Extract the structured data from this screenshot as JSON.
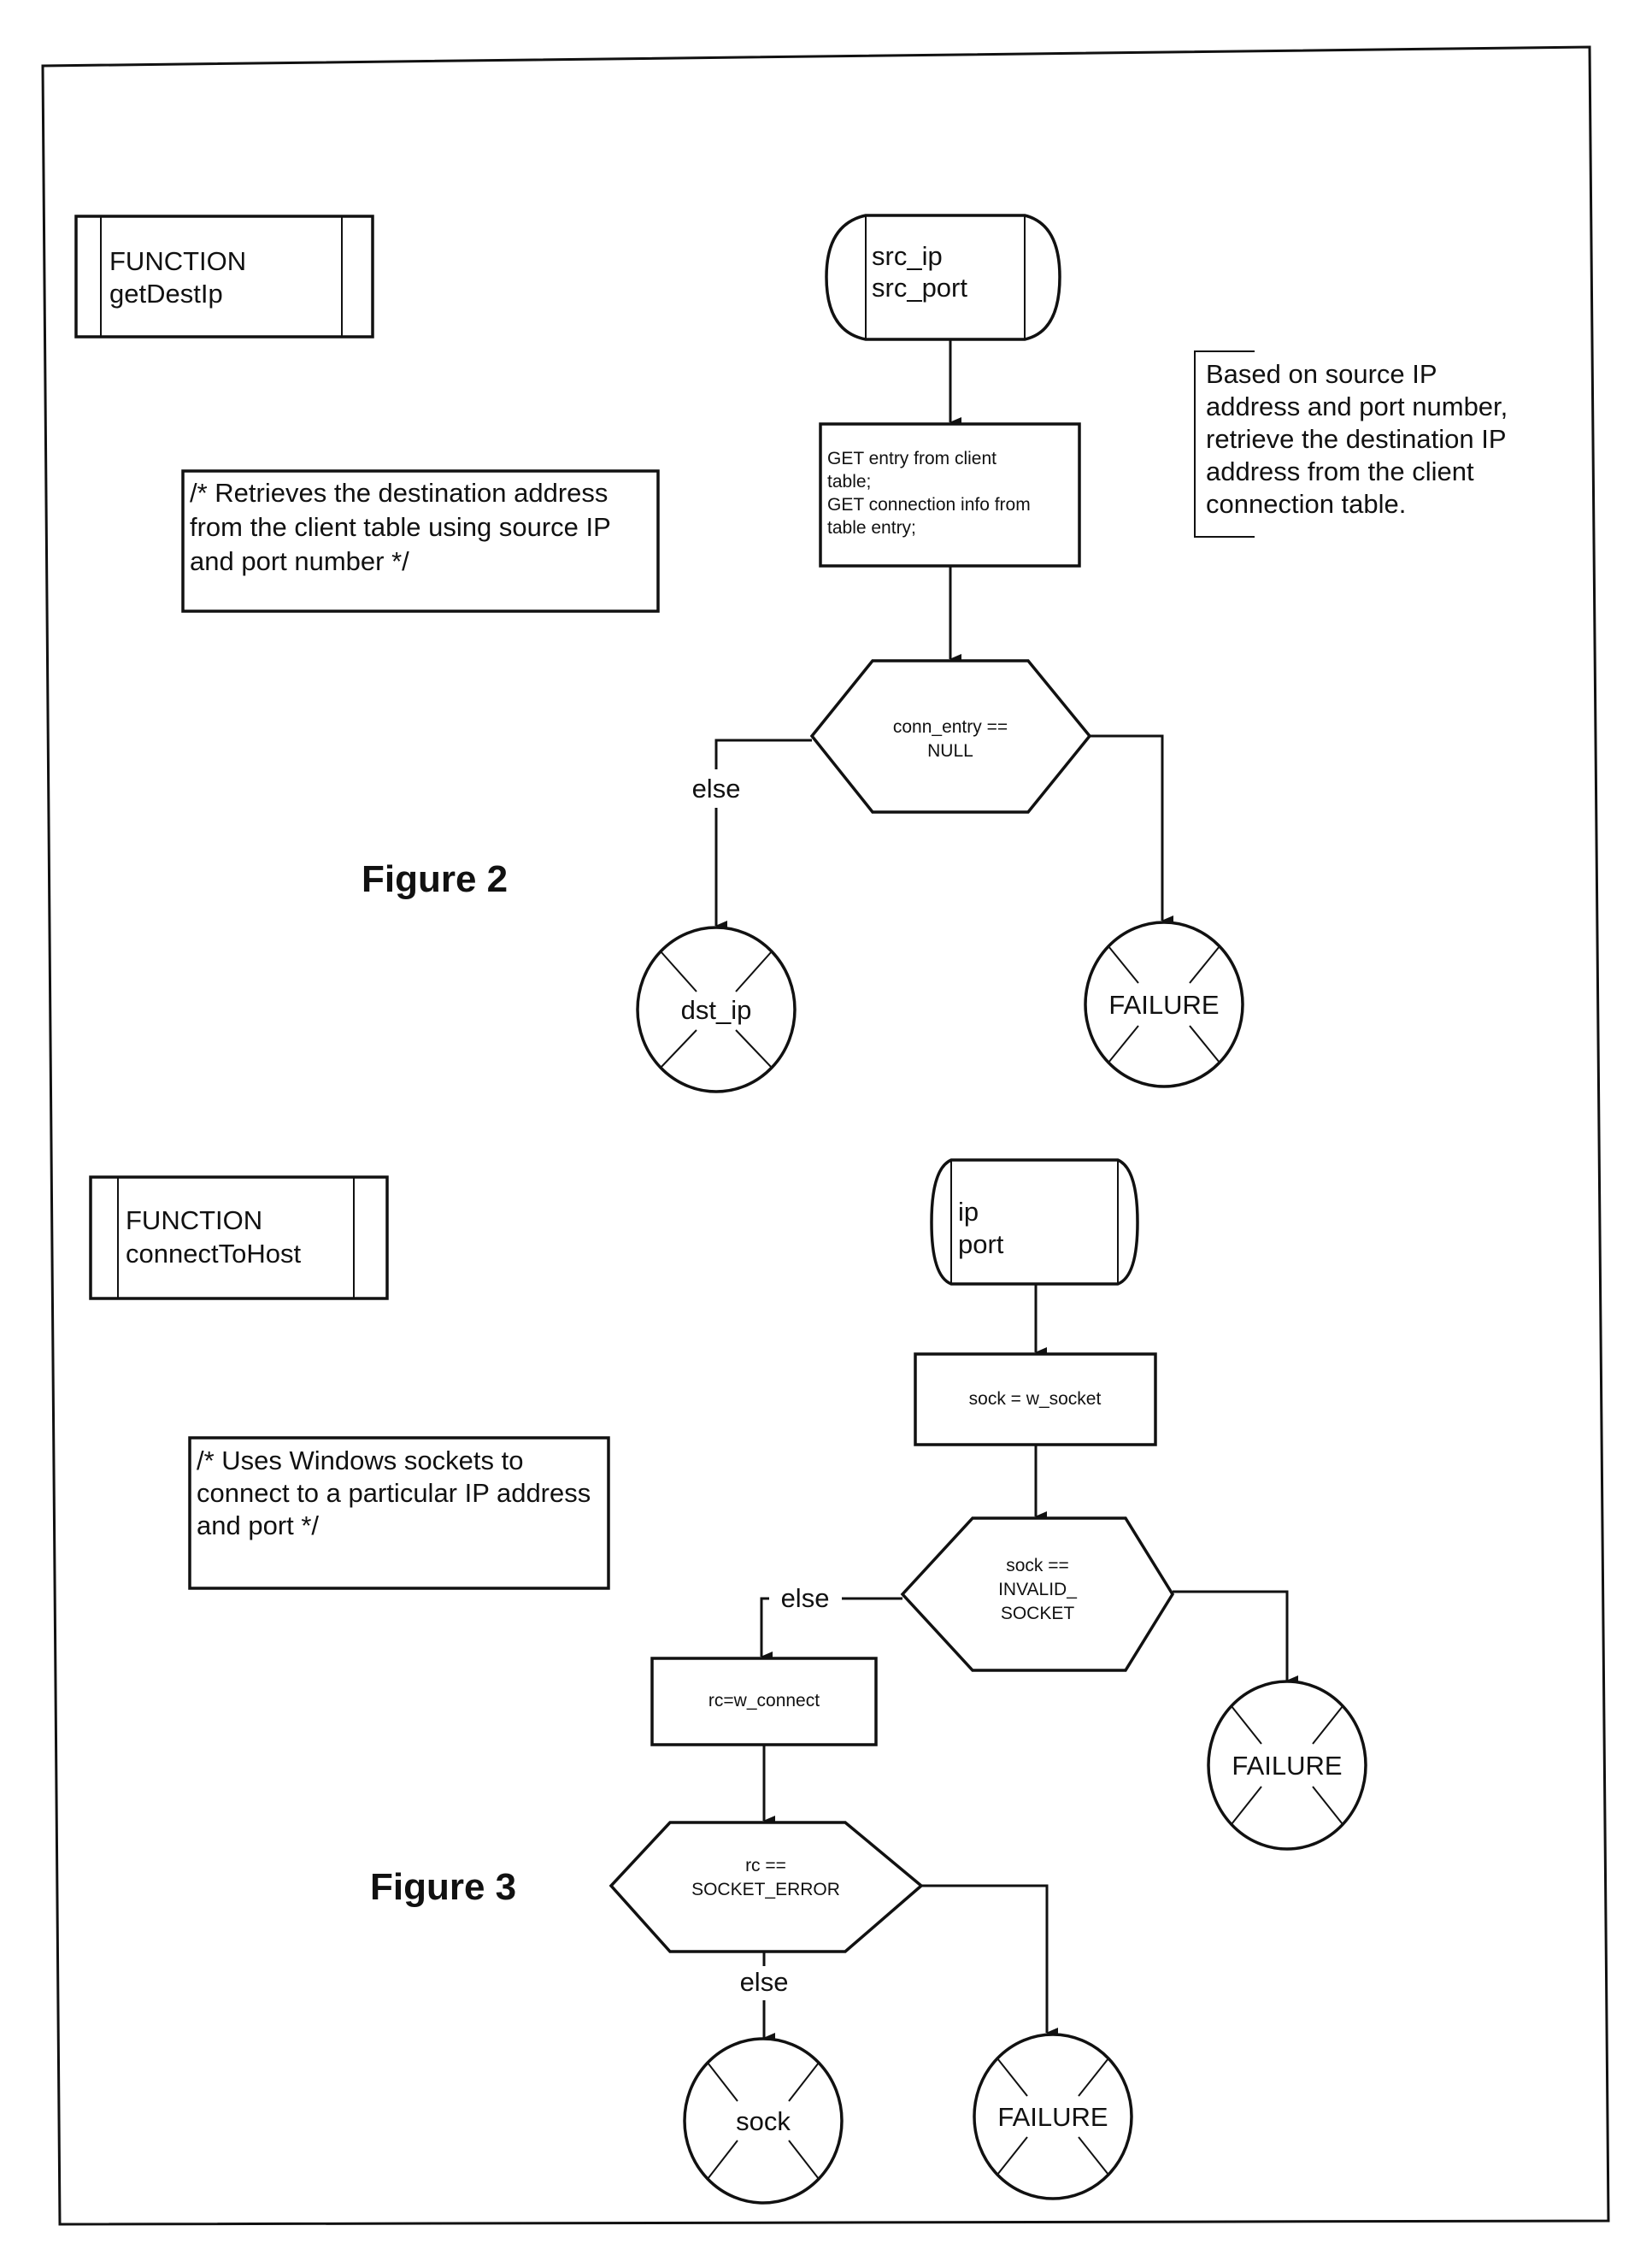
{
  "figure2": {
    "title": "Figure 2",
    "function_box": {
      "line1": "FUNCTION",
      "line2": "getDestIp"
    },
    "comment": {
      "lines": [
        "/* Retrieves the destination address",
        "from the client table using source IP",
        "and port number */"
      ]
    },
    "input_terminal": {
      "lines": [
        "src_ip",
        "src_port"
      ]
    },
    "process_box": {
      "lines": [
        "GET entry from client",
        "table;",
        "GET connection info from",
        "table entry;"
      ]
    },
    "annotation": {
      "lines": [
        "Based on source IP",
        "address and port number,",
        "retrieve the destination IP",
        "address from the client",
        "connection table."
      ]
    },
    "decision": {
      "lines": [
        "conn_entry ==",
        "NULL"
      ]
    },
    "else_label": "else",
    "return_success": "dst_ip",
    "return_failure": "FAILURE"
  },
  "figure3": {
    "title": "Figure 3",
    "function_box": {
      "line1": "FUNCTION",
      "line2": "connectToHost"
    },
    "comment": {
      "lines": [
        "/* Uses Windows sockets to",
        "connect to a particular IP address",
        "and port */"
      ]
    },
    "input_terminal": {
      "lines": [
        "ip",
        "port"
      ]
    },
    "socket_box": "sock = w_socket",
    "decision1": {
      "lines": [
        "sock ==",
        "INVALID_",
        "SOCKET"
      ]
    },
    "else_label1": "else",
    "failure1": "FAILURE",
    "connect_box": "rc=w_connect",
    "decision2": {
      "lines": [
        "rc ==",
        "SOCKET_ERROR"
      ]
    },
    "else_label2": "else",
    "return_success": "sock",
    "failure2": "FAILURE"
  }
}
